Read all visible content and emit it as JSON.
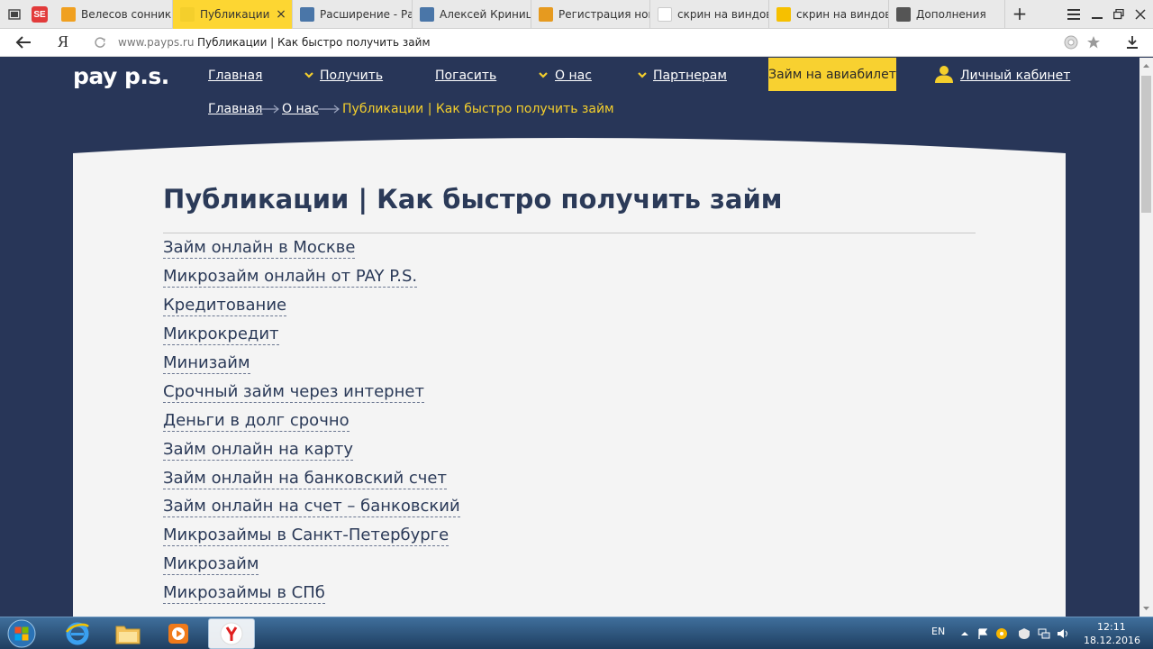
{
  "browser": {
    "tabs": [
      {
        "title": "Велесов сонник з",
        "favicon": "owl-favicon",
        "color": "#f0a020"
      },
      {
        "title": "Публикации | Как",
        "favicon": "payps-favicon",
        "color": "#f4cf2c",
        "active": true
      },
      {
        "title": "Расширение - Ра",
        "favicon": "vk-k-favicon",
        "color": "#4a76a8"
      },
      {
        "title": "Алексей Криницк",
        "favicon": "vk-favicon",
        "color": "#4a76a8"
      },
      {
        "title": "Регистрация нов",
        "favicon": "at-favicon",
        "color": "#e69a1f"
      },
      {
        "title": "скрин на виндов",
        "favicon": "yandex-favicon",
        "color": "#ffffff"
      },
      {
        "title": "скрин на виндов",
        "favicon": "image-favicon",
        "color": "#f6c000"
      },
      {
        "title": "Дополнения",
        "favicon": "addons-favicon",
        "color": "#555555"
      }
    ],
    "url": {
      "domain": "www.payps.ru",
      "title": "Публикации | Как быстро получить займ"
    },
    "yandex_letter": "Я"
  },
  "site": {
    "logo": "pay p.s.",
    "nav": [
      {
        "label": "Главная",
        "arrow": false
      },
      {
        "label": "Получить",
        "arrow": true
      },
      {
        "label": "Погасить",
        "arrow": false
      },
      {
        "label": "О нас",
        "arrow": true
      },
      {
        "label": "Партнерам",
        "arrow": true
      }
    ],
    "cta": "Займ на авиабилет",
    "cabinet": "Личный кабинет",
    "breadcrumb": {
      "home": "Главная",
      "about": "О нас",
      "current": "Публикации | Как быстро получить займ"
    },
    "page_title": "Публикации | Как быстро получить займ",
    "publications": [
      "Займ онлайн в Москве",
      "Микрозайм онлайн от PAY P.S.",
      "Кредитование",
      "Микрокредит",
      "Минизайм",
      "Срочный займ через интернет",
      "Деньги в долг срочно",
      "Займ онлайн на карту",
      "Займ онлайн на банковский счет",
      "Займ онлайн на счет – банковский",
      "Микрозаймы в Санкт-Петербурге",
      "Микрозайм",
      "Микрозаймы в СПб"
    ],
    "colors": {
      "navy": "#283658",
      "accent": "#f4cf2c",
      "card": "#f4f4f4"
    }
  },
  "taskbar": {
    "lang": "EN",
    "time": "12:11",
    "date": "18.12.2016"
  }
}
